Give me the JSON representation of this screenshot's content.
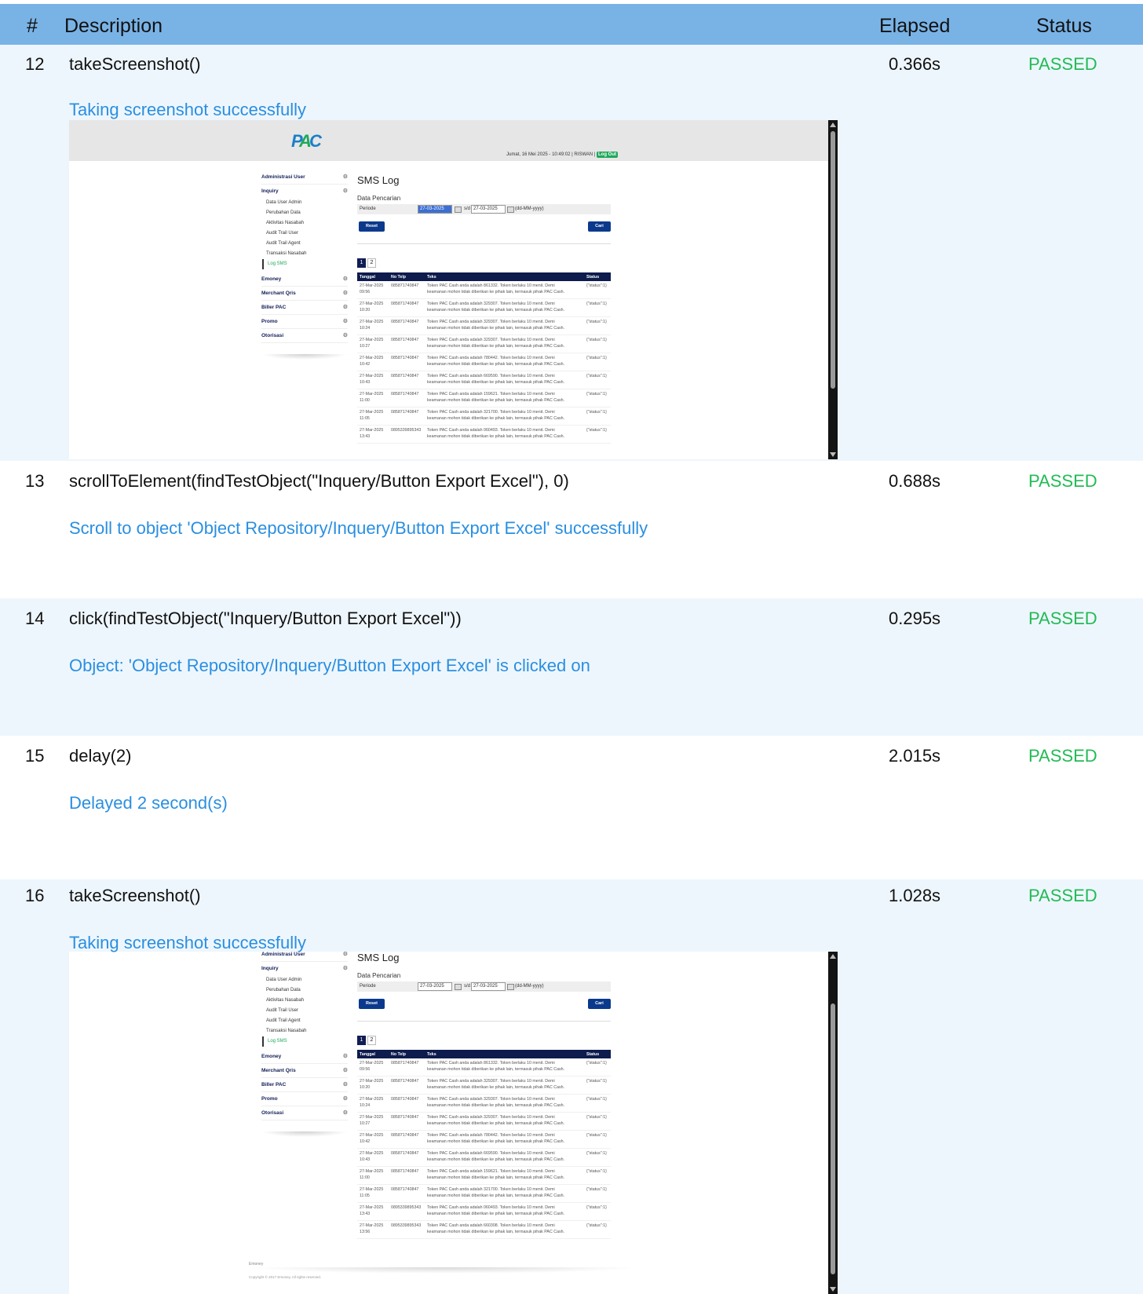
{
  "table_header": {
    "num": "#",
    "description": "Description",
    "elapsed": "Elapsed",
    "status": "Status"
  },
  "steps": [
    {
      "num": "12",
      "keyword": "takeScreenshot()",
      "elapsed": "0.366s",
      "status": "PASSED",
      "message": "Taking screenshot successfully"
    },
    {
      "num": "13",
      "keyword": "scrollToElement(findTestObject(\"Inquery/Button Export Excel\"), 0)",
      "elapsed": "0.688s",
      "status": "PASSED",
      "message": "Scroll to object 'Object Repository/Inquery/Button Export Excel' successfully"
    },
    {
      "num": "14",
      "keyword": "click(findTestObject(\"Inquery/Button Export Excel\"))",
      "elapsed": "0.295s",
      "status": "PASSED",
      "message": "Object: 'Object Repository/Inquery/Button Export Excel' is clicked on"
    },
    {
      "num": "15",
      "keyword": "delay(2)",
      "elapsed": "2.015s",
      "status": "PASSED",
      "message": "Delayed 2 second(s)"
    },
    {
      "num": "16",
      "keyword": "takeScreenshot()",
      "elapsed": "1.028s",
      "status": "PASSED",
      "message": "Taking screenshot successfully"
    }
  ],
  "app": {
    "logo_p": "P",
    "logo_a": "A",
    "logo_c": "C",
    "top_info": "Jumat, 16 Mei 2025 - 10:49:02 | RISWAN |",
    "logout": "Log Out",
    "sidebar": {
      "administrasi": "Administrasi User",
      "inquiry": "Inquiry",
      "inquiry_items": [
        "Data User Admin",
        "Perubahan Data",
        "Aktivitas Nasabah",
        "Audit Trail User",
        "Audit Trail Agent",
        "Transaksi Nasabah",
        "Log SMS"
      ],
      "emoney": "Emoney",
      "merchant": "Merchant Qris",
      "biller": "Biller PAC",
      "promo": "Promo",
      "otorisasi": "Otorisasi",
      "gear": "⚙"
    },
    "page_title": "SMS Log",
    "data_pencarian": "Data Pencarian",
    "periode_label": "Periode",
    "date_from": "27-03-2025",
    "sd_label": "s/d",
    "date_to": "27-03-2025",
    "format_hint": "(dd-MM-yyyy)",
    "reset": "Reset",
    "cari": "Cari",
    "pages": [
      "1",
      "2"
    ],
    "columns": [
      "Tanggal",
      "No Telp",
      "Teks",
      "Status"
    ],
    "rows": [
      {
        "date": "27-Mar-2025",
        "time": "09:56",
        "phone": "085871740847",
        "t1": "Token PAC Cash anda adalah 861332. Token berlaku 10 menit. Demi",
        "t2": "keamanan mohon tidak diberikan ke pihak lain, termasuk pihak PAC Cash.",
        "status": "{\"status\":1}"
      },
      {
        "date": "27-Mar-2025",
        "time": "10:20",
        "phone": "085871740847",
        "t1": "Token PAC Cash anda adalah 329307. Token berlaku 10 menit. Demi",
        "t2": "keamanan mohon tidak diberikan ke pihak lain, termasuk pihak PAC Cash.",
        "status": "{\"status\":1}"
      },
      {
        "date": "27-Mar-2025",
        "time": "10:24",
        "phone": "085871740847",
        "t1": "Token PAC Cash anda adalah 329307. Token berlaku 10 menit. Demi",
        "t2": "keamanan mohon tidak diberikan ke pihak lain, termasuk pihak PAC Cash.",
        "status": "{\"status\":1}"
      },
      {
        "date": "27-Mar-2025",
        "time": "10:27",
        "phone": "085871740847",
        "t1": "Token PAC Cash anda adalah 329307. Token berlaku 10 menit. Demi",
        "t2": "keamanan mohon tidak diberikan ke pihak lain, termasuk pihak PAC Cash.",
        "status": "{\"status\":1}"
      },
      {
        "date": "27-Mar-2025",
        "time": "10:42",
        "phone": "085871740847",
        "t1": "Token PAC Cash anda adalah 780442. Token berlaku 10 menit. Demi",
        "t2": "keamanan mohon tidak diberikan ke pihak lain, termasuk pihak PAC Cash.",
        "status": "{\"status\":1}"
      },
      {
        "date": "27-Mar-2025",
        "time": "10:43",
        "phone": "085871740847",
        "t1": "Token PAC Cash anda adalah 669590. Token berlaku 10 menit. Demi",
        "t2": "keamanan mohon tidak diberikan ke pihak lain, termasuk pihak PAC Cash.",
        "status": "{\"status\":1}"
      },
      {
        "date": "27-Mar-2025",
        "time": "11:00",
        "phone": "085871740847",
        "t1": "Token PAC Cash anda adalah 159621. Token berlaku 10 menit. Demi",
        "t2": "keamanan mohon tidak diberikan ke pihak lain, termasuk pihak PAC Cash.",
        "status": "{\"status\":1}"
      },
      {
        "date": "27-Mar-2025",
        "time": "11:05",
        "phone": "085871740847",
        "t1": "Token PAC Cash anda adalah 321700. Token berlaku 10 menit. Demi",
        "t2": "keamanan mohon tidak diberikan ke pihak lain, termasuk pihak PAC Cash.",
        "status": "{\"status\":1}"
      },
      {
        "date": "27-Mar-2025",
        "time": "13:43",
        "phone": "0895339895343",
        "t1": "Token PAC Cash anda adalah 060493. Token berlaku 10 menit. Demi",
        "t2": "keamanan mohon tidak diberikan ke pihak lain, termasuk pihak PAC Cash.",
        "status": "{\"status\":1}"
      },
      {
        "date": "27-Mar-2025",
        "time": "13:56",
        "phone": "0895339895343",
        "t1": "Token PAC Cash anda adalah 660308. Token berlaku 10 menit. Demi",
        "t2": "keamanan mohon tidak diberikan ke pihak lain, termasuk pihak PAC Cash.",
        "status": "{\"status\":1}"
      }
    ],
    "footer_brand": "Emoney",
    "footer_copyright": "Copyright © 2017 Emoney. All rights reserved."
  }
}
